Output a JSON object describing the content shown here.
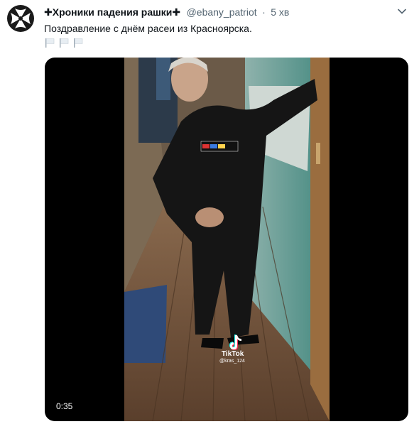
{
  "tweet": {
    "author_name": "✚Хроники падения рашки✚",
    "handle": "@ebany_patriot",
    "separator": "·",
    "time": "5 хв",
    "text": "Поздравление с днём расеи из Красноярска.",
    "flags": [
      "white-flag-icon",
      "white-flag-icon",
      "white-flag-icon"
    ]
  },
  "media": {
    "duration": "0:35",
    "watermark_brand": "TikTok",
    "watermark_user": "@kras_124"
  },
  "colors": {
    "text_primary": "#0f1419",
    "text_secondary": "#536471",
    "media_background": "#000000"
  }
}
